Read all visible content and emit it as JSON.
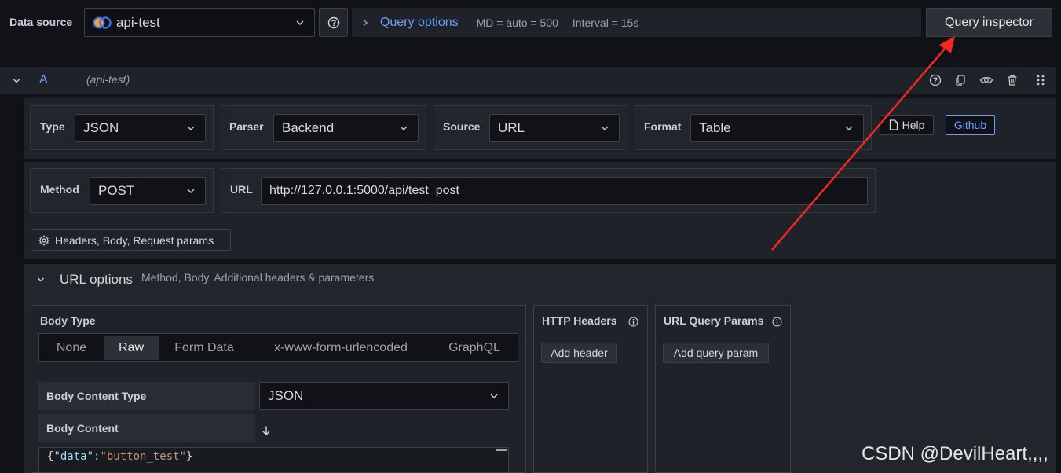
{
  "toolbar": {
    "data_source_label": "Data source",
    "data_source_value": "api-test",
    "help_icon": "question-circle-icon",
    "query_options_label": "Query options",
    "md_text": "MD = auto = 500",
    "interval_text": "Interval = 15s",
    "query_inspector_label": "Query inspector"
  },
  "query_row": {
    "ref_id": "A",
    "datasource_hint": "(api-test)",
    "actions": [
      "question-circle-icon",
      "copy-icon",
      "eye-icon",
      "trash-icon",
      "drag-handle-icon"
    ]
  },
  "fields": {
    "type_label": "Type",
    "type_value": "JSON",
    "parser_label": "Parser",
    "parser_value": "Backend",
    "source_label": "Source",
    "source_value": "URL",
    "format_label": "Format",
    "format_value": "Table",
    "help_label": "Help",
    "github_label": "Github",
    "method_label": "Method",
    "method_value": "POST",
    "url_label": "URL",
    "url_value": "http://127.0.0.1:5000/api/test_post",
    "headers_button_label": "Headers, Body, Request params"
  },
  "url_options": {
    "title": "URL options",
    "subtitle": "Method, Body, Additional headers & parameters",
    "body_type_label": "Body Type",
    "body_tabs": [
      "None",
      "Raw",
      "Form Data",
      "x-www-form-urlencoded",
      "GraphQL"
    ],
    "body_tab_selected": "Raw",
    "body_content_type_label": "Body Content Type",
    "body_content_type_value": "JSON",
    "body_content_label": "Body Content",
    "code": {
      "open": "{",
      "key": "\"data\"",
      "colon": ":",
      "value": "\"button_test\"",
      "close": "}"
    },
    "http_headers_label": "HTTP Headers",
    "add_header_label": "Add header",
    "query_params_label": "URL Query Params",
    "add_query_param_label": "Add query param"
  },
  "watermark": "CSDN @DevilHeart,,,,",
  "colors": {
    "accent_blue": "#6e9fff",
    "annotation_red": "#f4281e",
    "background": "#111217",
    "panel": "#22252b"
  }
}
